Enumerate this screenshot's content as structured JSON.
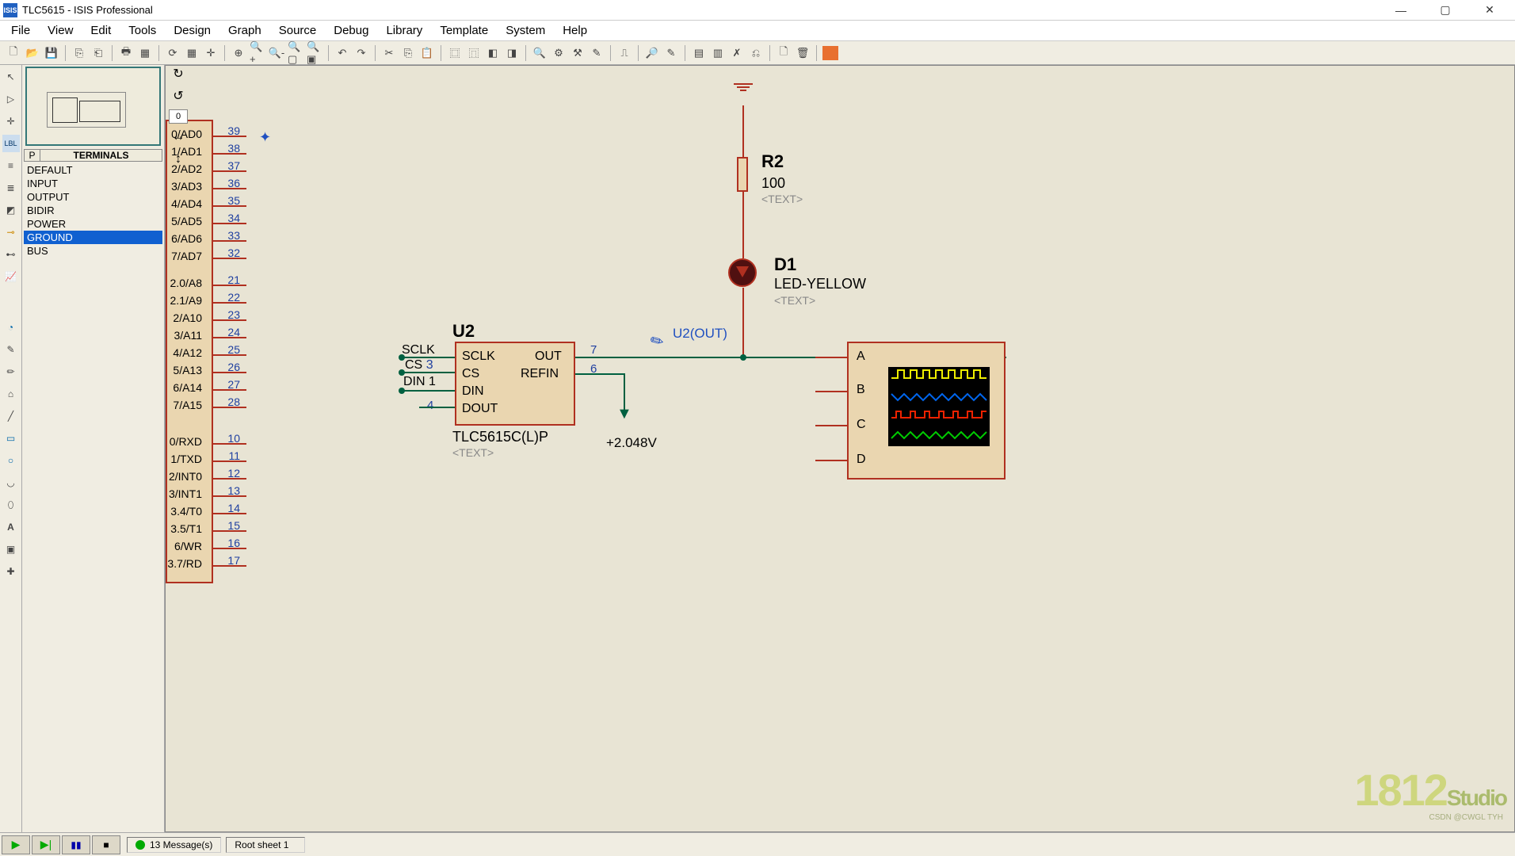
{
  "window": {
    "title": "TLC5615 - ISIS Professional",
    "logo": "ISIS"
  },
  "menu": [
    "File",
    "View",
    "Edit",
    "Tools",
    "Design",
    "Graph",
    "Source",
    "Debug",
    "Library",
    "Template",
    "System",
    "Help"
  ],
  "side_panel": {
    "degree_value": "0",
    "header_p": "P",
    "header_label": "TERMINALS",
    "terminals": [
      "DEFAULT",
      "INPUT",
      "OUTPUT",
      "BIDIR",
      "POWER",
      "GROUND",
      "BUS"
    ],
    "selected": "GROUND"
  },
  "schematic": {
    "mcu_pins_block1": [
      {
        "label": "0/AD0",
        "num": "39"
      },
      {
        "label": "1/AD1",
        "num": "38"
      },
      {
        "label": "2/AD2",
        "num": "37"
      },
      {
        "label": "3/AD3",
        "num": "36"
      },
      {
        "label": "4/AD4",
        "num": "35"
      },
      {
        "label": "5/AD5",
        "num": "34"
      },
      {
        "label": "6/AD6",
        "num": "33"
      },
      {
        "label": "7/AD7",
        "num": "32"
      }
    ],
    "mcu_pins_block2": [
      {
        "label": "2.0/A8",
        "num": "21"
      },
      {
        "label": "2.1/A9",
        "num": "22"
      },
      {
        "label": "2/A10",
        "num": "23"
      },
      {
        "label": "3/A11",
        "num": "24"
      },
      {
        "label": "4/A12",
        "num": "25"
      },
      {
        "label": "5/A13",
        "num": "26"
      },
      {
        "label": "6/A14",
        "num": "27"
      },
      {
        "label": "7/A15",
        "num": "28"
      }
    ],
    "mcu_pins_block3": [
      {
        "label": "0/RXD",
        "num": "10"
      },
      {
        "label": "1/TXD",
        "num": "11"
      },
      {
        "label": "2/INT0",
        "num": "12"
      },
      {
        "label": "3/INT1",
        "num": "13"
      },
      {
        "label": "3.4/T0",
        "num": "14"
      },
      {
        "label": "3.5/T1",
        "num": "15"
      },
      {
        "label": "6/WR",
        "num": "16"
      },
      {
        "label": "3.7/RD",
        "num": "17"
      }
    ],
    "u2": {
      "ref": "U2",
      "part": "TLC5615C(L)P",
      "text": "<TEXT>",
      "pins_left": [
        {
          "name": "SCLK",
          "num": "",
          "net": "SCLK"
        },
        {
          "name": "CS",
          "num": "3",
          "net": "CS"
        },
        {
          "name": "DIN",
          "num": "",
          "net": "DIN 1"
        },
        {
          "name": "DOUT",
          "num": "4",
          "net": ""
        }
      ],
      "pins_right": [
        {
          "name": "OUT",
          "num": "7"
        },
        {
          "name": "REFIN",
          "num": "6"
        }
      ]
    },
    "r2": {
      "ref": "R2",
      "value": "100",
      "text": "<TEXT>"
    },
    "d1": {
      "ref": "D1",
      "value": "LED-YELLOW",
      "text": "<TEXT>"
    },
    "probe_label": "U2(OUT)",
    "refin_voltage": "+2.048V",
    "scope_channels": [
      "A",
      "B",
      "C",
      "D"
    ]
  },
  "statusbar": {
    "messages": "13 Message(s)",
    "sheet": "Root sheet 1"
  },
  "watermark": {
    "main": "1812",
    "sub": "CSDN @CWGL TYH"
  }
}
